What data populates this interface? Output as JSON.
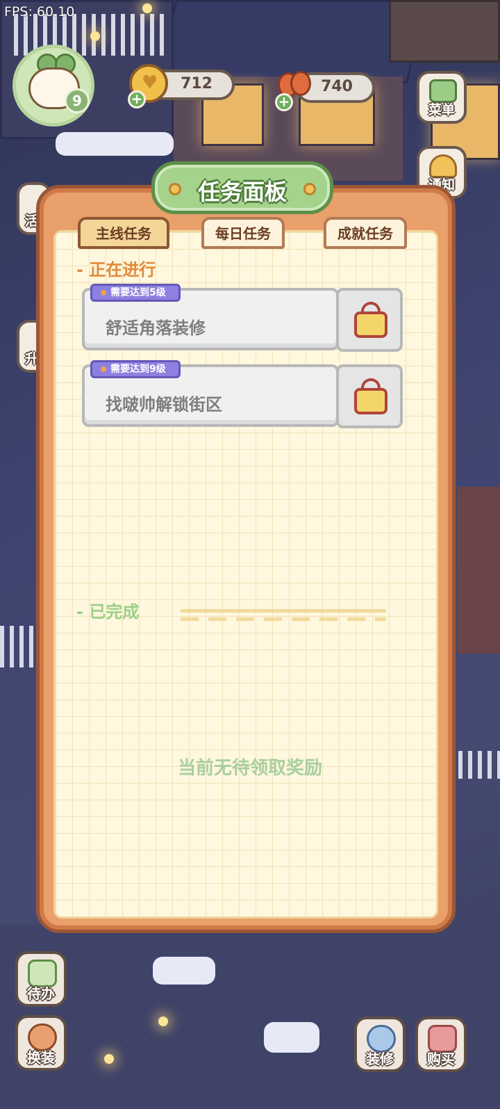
{
  "hud": {
    "fps": "FPS: 60.10",
    "player_level": "9",
    "coins": "712",
    "carrots": "740"
  },
  "side_buttons": {
    "menu": "菜单",
    "notice": "通知",
    "activity_partial": "活",
    "upgrade_partial": "升"
  },
  "panel": {
    "title": "任务面板",
    "tabs": [
      "主线任务",
      "每日任务",
      "成就任务"
    ],
    "active_tab": "主线任务",
    "ongoing_label": "正在进行",
    "completed_label": "已完成",
    "tasks": [
      {
        "tag": "需要达到5级",
        "name": "舒适角落装修",
        "locked": true
      },
      {
        "tag": "需要达到9级",
        "name": "找啵帅解锁街区",
        "locked": true
      }
    ],
    "empty_message": "当前无待领取奖励"
  },
  "bottom_buttons": {
    "todo": "待办",
    "outfit": "换装",
    "decorate": "装修",
    "buy": "购买"
  },
  "colors": {
    "panel_frame": "#e9a06a",
    "title_banner": "#a6d38c",
    "tag_purple": "#8d80e0",
    "ongoing_orange": "#e08a3a",
    "completed_green": "#9ccf86"
  }
}
